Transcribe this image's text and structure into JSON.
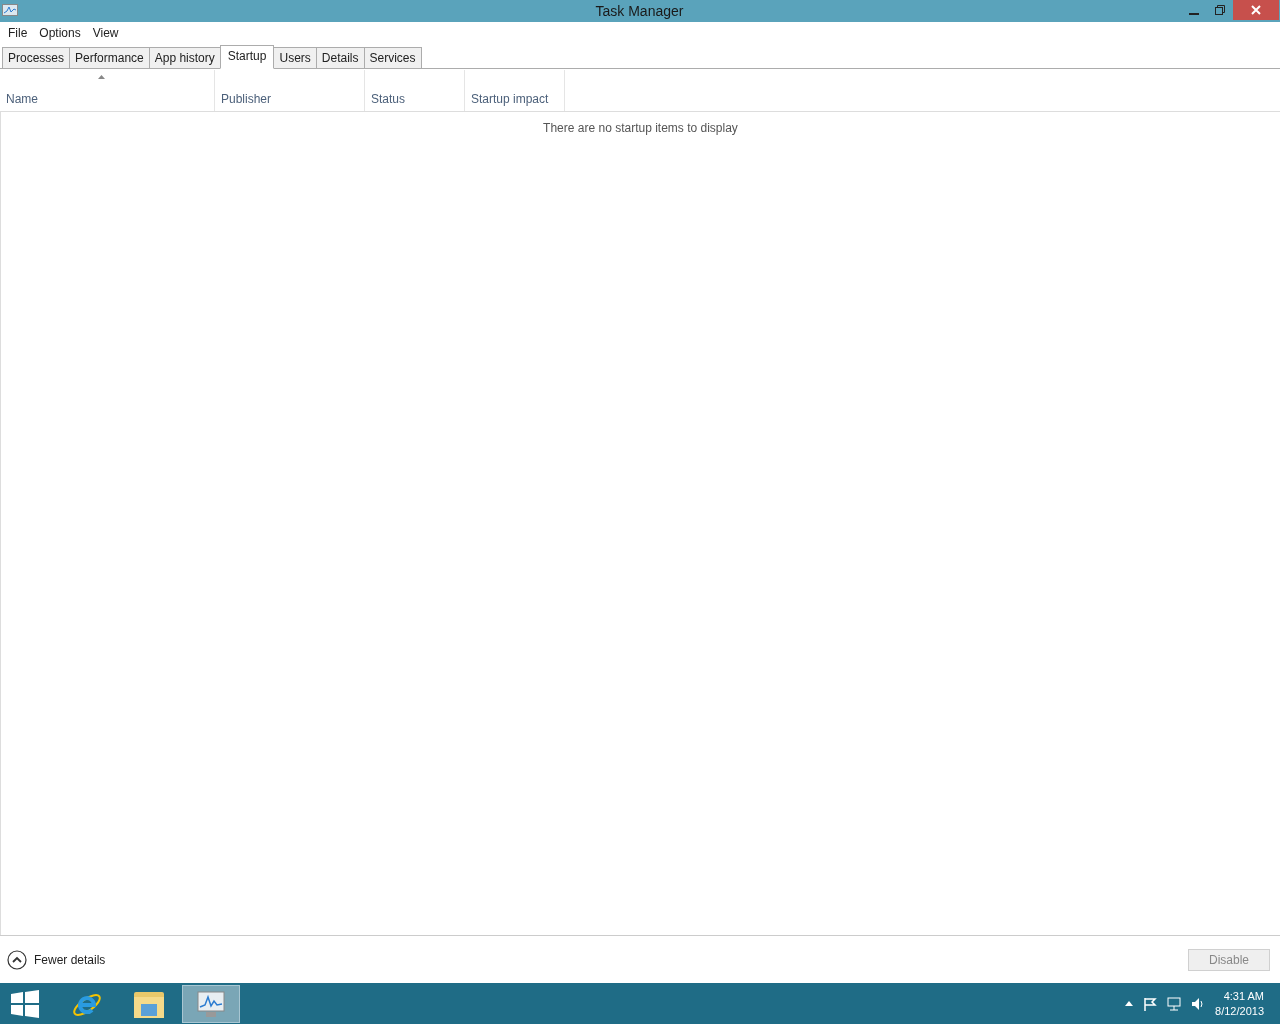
{
  "window": {
    "title": "Task Manager"
  },
  "menu": [
    "File",
    "Options",
    "View"
  ],
  "tabs": [
    {
      "label": "Processes",
      "selected": false
    },
    {
      "label": "Performance",
      "selected": false
    },
    {
      "label": "App history",
      "selected": false
    },
    {
      "label": "Startup",
      "selected": true
    },
    {
      "label": "Users",
      "selected": false
    },
    {
      "label": "Details",
      "selected": false
    },
    {
      "label": "Services",
      "selected": false
    }
  ],
  "table": {
    "columns": [
      {
        "label": "Name",
        "sorted": true
      },
      {
        "label": "Publisher",
        "sorted": false
      },
      {
        "label": "Status",
        "sorted": false
      },
      {
        "label": "Startup impact",
        "sorted": false
      }
    ],
    "empty_message": "There are no startup items to display"
  },
  "footer": {
    "details_toggle": "Fewer details",
    "button": {
      "label": "Disable",
      "disabled": true
    }
  },
  "taskbar": {
    "apps": [
      {
        "kind": "browser",
        "active": false
      },
      {
        "kind": "folder",
        "active": false
      },
      {
        "kind": "taskmgr",
        "active": true
      }
    ],
    "clock": {
      "time": "4:31 AM",
      "date": "8/12/2013"
    }
  }
}
